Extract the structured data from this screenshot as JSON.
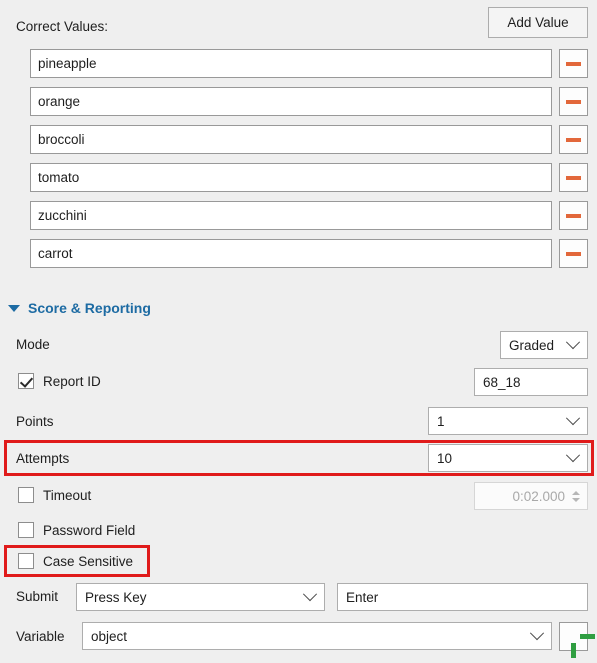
{
  "correct_values": {
    "label": "Correct Values:",
    "add_button": "Add Value",
    "items": [
      {
        "value": "pineapple"
      },
      {
        "value": "orange"
      },
      {
        "value": "broccoli"
      },
      {
        "value": "tomato"
      },
      {
        "value": "zucchini"
      },
      {
        "value": "carrot"
      }
    ]
  },
  "score_reporting": {
    "title": "Score & Reporting",
    "mode": {
      "label": "Mode",
      "value": "Graded"
    },
    "report_id": {
      "label": "Report ID",
      "checked": true,
      "value": "68_18"
    },
    "points": {
      "label": "Points",
      "value": "1"
    },
    "attempts": {
      "label": "Attempts",
      "value": "10"
    },
    "timeout": {
      "label": "Timeout",
      "checked": false,
      "value": "0:02.000"
    },
    "password_field": {
      "label": "Password Field",
      "checked": false
    },
    "case_sensitive": {
      "label": "Case Sensitive",
      "checked": false
    },
    "submit": {
      "label": "Submit",
      "mode": "Press Key",
      "key": "Enter"
    },
    "variable": {
      "label": "Variable",
      "value": "object"
    }
  },
  "colors": {
    "background": "#efefef",
    "accent_blue": "#1d6ba3",
    "remove_orange": "#e2673a",
    "add_green": "#2f9e41",
    "highlight_red": "#e01b1b"
  }
}
